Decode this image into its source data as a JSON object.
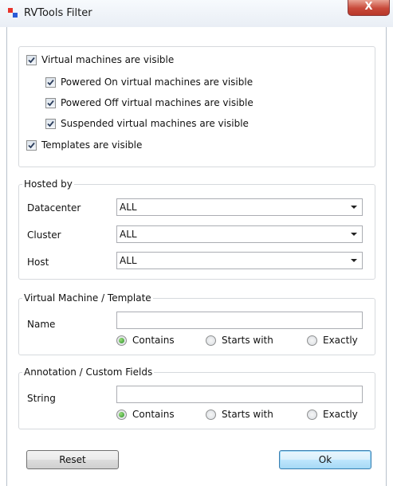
{
  "window": {
    "title": "RVTools Filter",
    "close_glyph": "X",
    "icon": "rvtools-app-icon",
    "icon_colors": [
      "#e8332a",
      "#2a5bd7"
    ]
  },
  "visibility": {
    "vms_visible": {
      "label": "Virtual machines are visible",
      "checked": true
    },
    "powered_on": {
      "label": "Powered On virtual machines are visible",
      "checked": true
    },
    "powered_off": {
      "label": "Powered Off virtual machines are visible",
      "checked": true
    },
    "suspended": {
      "label": "Suspended virtual machines are visible",
      "checked": true
    },
    "templates": {
      "label": "Templates are visible",
      "checked": true
    }
  },
  "hosted_by": {
    "legend": "Hosted by",
    "datacenter": {
      "label": "Datacenter",
      "value": "ALL"
    },
    "cluster": {
      "label": "Cluster",
      "value": "ALL"
    },
    "host": {
      "label": "Host",
      "value": "ALL"
    }
  },
  "vm_template": {
    "legend": "Virtual Machine / Template",
    "name_label": "Name",
    "name_value": "",
    "options": [
      "Contains",
      "Starts with",
      "Exactly"
    ],
    "selected": "Contains"
  },
  "annotation": {
    "legend": "Annotation / Custom Fields",
    "string_label": "String",
    "string_value": "",
    "options": [
      "Contains",
      "Starts with",
      "Exactly"
    ],
    "selected": "Contains"
  },
  "buttons": {
    "reset": "Reset",
    "ok": "Ok"
  }
}
